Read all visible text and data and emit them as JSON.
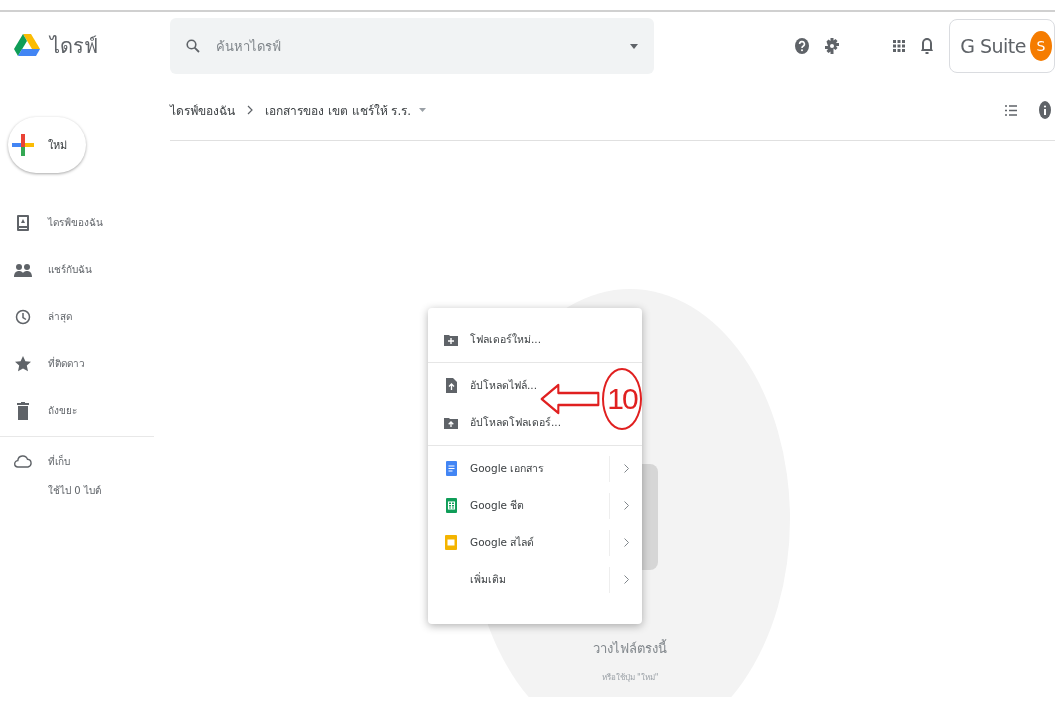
{
  "app": {
    "name": "ไดรฟ์"
  },
  "search": {
    "placeholder": "ค้นหาไดรฟ์"
  },
  "account": {
    "brand": "G Suite",
    "avatar": "S"
  },
  "new_button": {
    "label": "ใหม่"
  },
  "sidebar": {
    "items": [
      {
        "kind": "drive",
        "label": "ไดรฟ์ของฉัน"
      },
      {
        "kind": "shared",
        "label": "แชร์กับฉัน"
      },
      {
        "kind": "recent",
        "label": "ล่าสุด"
      },
      {
        "kind": "starred",
        "label": "ที่ติดดาว"
      },
      {
        "kind": "trash",
        "label": "ถังขยะ"
      }
    ]
  },
  "storage": {
    "label": "ที่เก็บ",
    "usage": "ใช้ไป 0 ไบต์"
  },
  "breadcrumb": [
    "ไดรฟ์ของฉัน",
    "เอกสารของ เขต แชร์ให้ ร.ร."
  ],
  "menu": {
    "groups": [
      [
        {
          "kind": "new-folder",
          "label": "โฟลเดอร์ใหม่...",
          "submenu": false
        }
      ],
      [
        {
          "kind": "upload-file",
          "label": "อัปโหลดไฟล์...",
          "submenu": false
        },
        {
          "kind": "upload-folder",
          "label": "อัปโหลดโฟลเดอร์...",
          "submenu": false
        }
      ],
      [
        {
          "kind": "docs",
          "label": "Google เอกสาร",
          "submenu": true
        },
        {
          "kind": "sheets",
          "label": "Google ชีต",
          "submenu": true
        },
        {
          "kind": "slides",
          "label": "Google สไลด์",
          "submenu": true
        },
        {
          "kind": "more",
          "label": "เพิ่มเติม",
          "submenu": true
        }
      ]
    ]
  },
  "annotation": {
    "number": "10"
  },
  "empty_state": {
    "title": "วางไฟล์ตรงนี้",
    "hint": "หรือใช้ปุ่ม \"ใหม่\""
  }
}
